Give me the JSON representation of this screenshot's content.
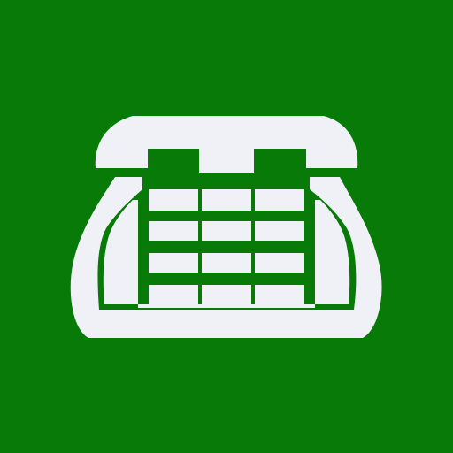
{
  "app_icon": {
    "icon": "desk-telephone-icon",
    "colors": {
      "background": "#077A07",
      "glyph": "#EFF1F7"
    },
    "keypad": {
      "rows": 4,
      "columns": 3
    }
  }
}
